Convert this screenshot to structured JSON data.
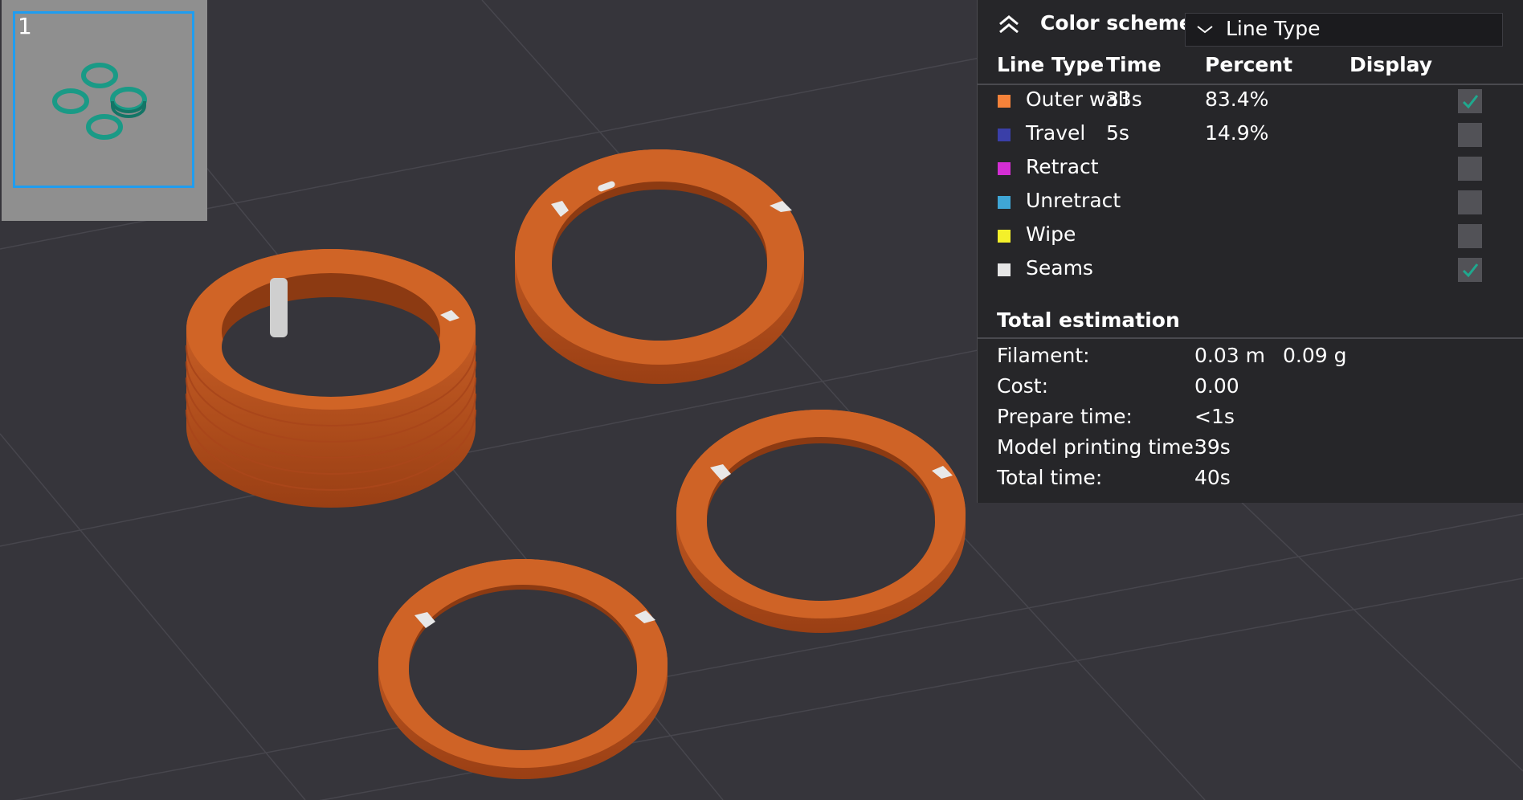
{
  "plate": {
    "number": "1"
  },
  "color_scheme": {
    "title": "Color scheme",
    "selected": "Line Type",
    "collapse_icon": "double-chevron-up-icon"
  },
  "columns": {
    "line_type": "Line Type",
    "time": "Time",
    "percent": "Percent",
    "display": "Display"
  },
  "line_types": [
    {
      "name": "Outer wall",
      "time": "33s",
      "percent": "83.4%",
      "color": "#f5823a",
      "display": true
    },
    {
      "name": "Travel",
      "time": "5s",
      "percent": "14.9%",
      "color": "#3a3fa8",
      "display": false
    },
    {
      "name": "Retract",
      "time": "",
      "percent": "",
      "color": "#d42ed4",
      "display": false
    },
    {
      "name": "Unretract",
      "time": "",
      "percent": "",
      "color": "#3fa6d6",
      "display": false
    },
    {
      "name": "Wipe",
      "time": "",
      "percent": "",
      "color": "#f4f02a",
      "display": false
    },
    {
      "name": "Seams",
      "time": "",
      "percent": "",
      "color": "#e6e6e6",
      "display": true
    }
  ],
  "total_estimation": {
    "title": "Total estimation",
    "filament_label": "Filament:",
    "filament_length": "0.03 m",
    "filament_weight": "0.09 g",
    "cost_label": "Cost:",
    "cost": "0.00",
    "prepare_label": "Prepare time:",
    "prepare": "<1s",
    "model_label": "Model printing time:",
    "model": "39s",
    "total_label": "Total time:",
    "total": "40s"
  },
  "colors": {
    "accent": "#1f9df0",
    "check": "#1fa88e",
    "ring": "#c8561e",
    "bed": "#36353b",
    "panel": "#262629"
  }
}
